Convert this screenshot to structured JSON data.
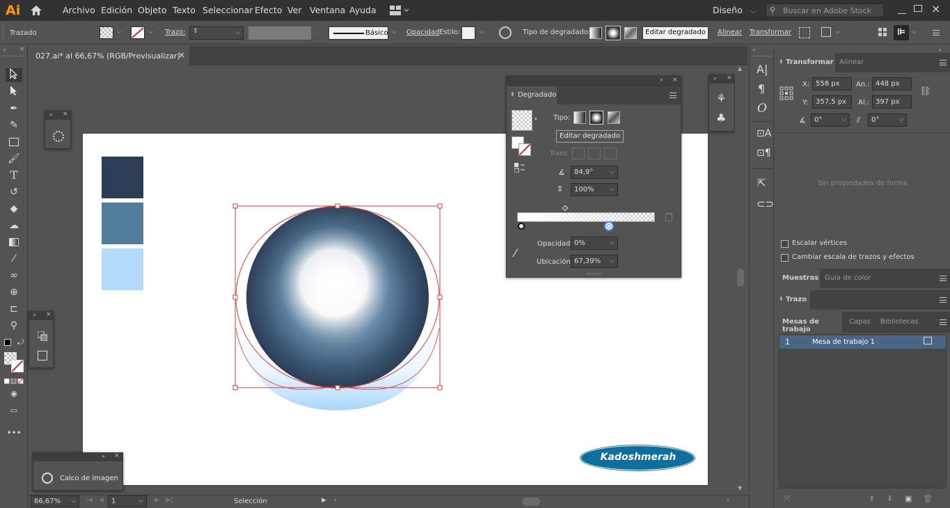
{
  "app": {
    "logo": "Ai",
    "menu": [
      "Archivo",
      "Edición",
      "Objeto",
      "Texto",
      "Seleccionar",
      "Efecto",
      "Ver",
      "Ventana",
      "Ayuda"
    ],
    "workspace": "Diseño",
    "stock_search_placeholder": "Buscar en Adobe Stock"
  },
  "control_bar": {
    "selection_type": "Trazado",
    "stroke_label": "Trazo:",
    "stroke_style": "Básico",
    "opacity_label": "Opacidad",
    "style_label": "Estilo:",
    "gradient_type_label": "Tipo de degradado:",
    "edit_gradient_button": "Editar degradado",
    "align_label": "Alinear",
    "transform_label": "Transformar"
  },
  "document_tab": {
    "title": "027.ai* al 66,67% (RGB/Previsualizar)",
    "close": "×"
  },
  "gradient_panel": {
    "title": "Degradado",
    "type_label": "Tipo:",
    "edit_button": "Editar degradado",
    "stroke_label": "Trazo:",
    "angle": "84,9°",
    "aspect": "100%",
    "opacity_label": "Opacidad:",
    "opacity_value": "0%",
    "location_label": "Ubicación:",
    "location_value": "67,39%"
  },
  "image_trace_panel": {
    "label": "Calco de imagen"
  },
  "transform_panel": {
    "tabs": [
      "Transformar",
      "Alinear"
    ],
    "x_label": "X:",
    "x_value": "558 px",
    "y_label": "Y:",
    "y_value": "357,5 px",
    "w_label": "An.:",
    "w_value": "448 px",
    "h_label": "Al.:",
    "h_value": "397 px",
    "rotate_value": "0°",
    "shear_value": "0°",
    "no_shape_props": "Sin propiedades de forma",
    "scale_corners": "Escalar vértices",
    "scale_strokes": "Cambiar escala de trazos y efectos"
  },
  "swatches_panel": {
    "tabs": [
      "Muestras",
      "Guía de color"
    ]
  },
  "stroke_panel": {
    "title": "Trazo"
  },
  "artboards_panel": {
    "tabs": [
      "Mesas de trabajo",
      "Capas",
      "Bibliotecas"
    ],
    "rows": [
      {
        "index": "1",
        "name": "Mesa de trabajo 1"
      }
    ]
  },
  "status_bar": {
    "zoom": "66,67%",
    "artboard_number": "1",
    "tool_status": "Selección"
  },
  "artwork": {
    "swatch_colors": [
      "#2c3e55",
      "#537d9c",
      "#b3dcfb"
    ],
    "watermark": "Kadoshmerah",
    "watermark_color": "#0f6e9c"
  },
  "colors": {
    "ui_bg": "#535353",
    "ui_dark": "#323232",
    "panel_header": "#424242",
    "selection_red": "#e03a3a",
    "accent": "#ff9a00"
  }
}
